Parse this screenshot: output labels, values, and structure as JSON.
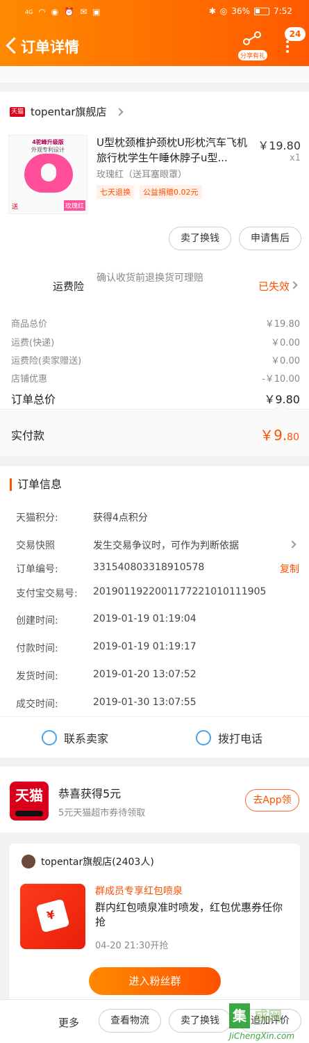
{
  "status_bar": {
    "signal": "4G",
    "battery": "36%",
    "time": "7:52"
  },
  "header": {
    "title": "订单详情",
    "share_label": "分享有礼",
    "badge": "24"
  },
  "shop": {
    "name": "topentar旗舰店",
    "platform_tag": "天猫"
  },
  "product": {
    "image_top": "4驼峰升级版",
    "image_sub": "外观专利设计",
    "image_bottom": "送",
    "image_tag": "玫瑰红",
    "title": "U型枕颈椎护颈枕U形枕汽车飞机旅行枕学生午睡休脖子u型...",
    "price": "￥19.80",
    "qty": "x1",
    "sku": "玫瑰红（送耳塞眼罩）",
    "tags": [
      "七天退换",
      "公益捐赠0.02元"
    ]
  },
  "actions": {
    "exchange": "卖了换钱",
    "after_sale": "申请售后"
  },
  "insurance": {
    "label": "运费险",
    "desc": "确认收货前退换货可理赔",
    "status": "已失效"
  },
  "fees": [
    {
      "k": "商品总价",
      "v": "￥19.80"
    },
    {
      "k": "运费(快递)",
      "v": "￥0.00"
    },
    {
      "k": "运费险(卖家赠送)",
      "v": "￥0.00"
    },
    {
      "k": "店铺优惠",
      "v": "-￥10.00"
    }
  ],
  "total": {
    "k": "订单总价",
    "v": "￥9.80"
  },
  "paid": {
    "k": "实付款",
    "v_main": "￥9.",
    "v_dec": "80"
  },
  "order_info": {
    "title": "订单信息",
    "rows": [
      {
        "k": "天猫积分:",
        "v": "获得4点积分"
      },
      {
        "k": "交易快照",
        "v": "发生交易争议时，可作为判断依据"
      },
      {
        "k": "订单编号:",
        "v": "331540803318910578"
      },
      {
        "k": "支付宝交易号:",
        "v": "2019011922001177221010111905"
      },
      {
        "k": "创建时间:",
        "v": "2019-01-19 01:19:04"
      },
      {
        "k": "付款时间:",
        "v": "2019-01-19 01:19:17"
      },
      {
        "k": "发货时间:",
        "v": "2019-01-20 13:07:52"
      },
      {
        "k": "成交时间:",
        "v": "2019-01-30 13:07:55"
      }
    ],
    "copy": "复制",
    "contact_seller": "联系卖家",
    "call": "拨打电话"
  },
  "promo": {
    "logo": "天猫",
    "title": "恭喜获得5元",
    "sub": "5元天猫超市券待领取",
    "button": "去App领"
  },
  "group": {
    "shop": "topentar旗舰店(2403人)",
    "t1": "群成员专享红包喷泉",
    "t2": "群内红包喷泉准时喷发，红包优惠券任你抢",
    "t3": "04-20 21:30开抢",
    "button": "进入粉丝群"
  },
  "bottom": {
    "more": "更多",
    "logistics": "查看物流",
    "exchange": "卖了换钱",
    "review": "追加评价"
  },
  "watermark": {
    "box": "集",
    "text": "成网",
    "url": "JiChengXin.com"
  }
}
